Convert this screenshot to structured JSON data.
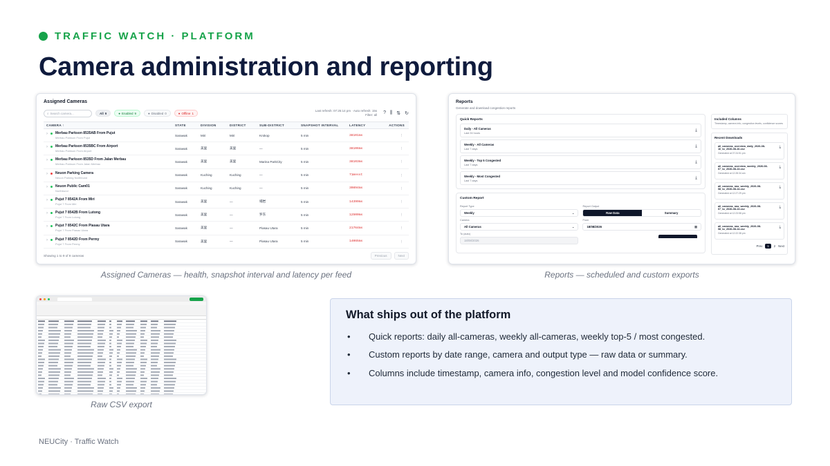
{
  "slide": {
    "eyebrow": "TRAFFIC WATCH · PLATFORM",
    "title": "Camera administration and reporting",
    "footer": "NEUCity · Traffic Watch",
    "accent_color": "#16a34a",
    "title_color": "#0f1b3d"
  },
  "cameras_panel": {
    "title": "Assigned Cameras",
    "search_placeholder": "Search camera...",
    "filters": [
      {
        "label": "All",
        "count": "9"
      },
      {
        "label": "Enabled",
        "count": "9"
      },
      {
        "label": "Disabled",
        "count": "0"
      },
      {
        "label": "Offline",
        "count": "1"
      }
    ],
    "refresh_text": "Last refresh: 07:25:14 pm · Auto refresh: 15s",
    "filter_text": "Filter: all",
    "columns": [
      "CAMERA ↑",
      "STATE",
      "DIVISION",
      "DISTRICT",
      "SUB-DISTRICT",
      "SNAPSHOT INTERVAL",
      "LATENCY",
      "ACTIONS"
    ],
    "rows": [
      {
        "name": "Merbau Parkson 8535AB From Pujut",
        "sub": "Merbau Parkson From Pujut",
        "status": "green",
        "state": "Sarawak",
        "division": "Miri",
        "district": "Miri",
        "subdistrict": "Krokop",
        "interval": "5 min",
        "latency": "38101ms"
      },
      {
        "name": "Merbau Parkson 8535BC From Airport",
        "sub": "Merbau Parkson From Airport",
        "status": "green",
        "state": "Sarawak",
        "division": "美里",
        "district": "美里",
        "subdistrict": "—",
        "interval": "5 min",
        "latency": "38106ms"
      },
      {
        "name": "Merbau Parkson 8535D From Jalan Merbau",
        "sub": "Merbau Parkson From Jalan Merbau",
        "status": "green",
        "state": "Sarawak",
        "division": "美里",
        "district": "美里",
        "subdistrict": "Marina ParkCity",
        "interval": "5 min",
        "latency": "38103ms"
      },
      {
        "name": "Neuon Parking Camera",
        "sub": "Neuon Parking Northbund",
        "status": "red",
        "state": "Sarawak",
        "division": "Kuching",
        "district": "Kuching",
        "subdistrict": "—",
        "interval": "5 min",
        "latency": "71messt"
      },
      {
        "name": "Neuon Public Cam01",
        "sub": "Northbund",
        "status": "green",
        "state": "Sarawak",
        "division": "Kuching",
        "district": "Kuching",
        "subdistrict": "—",
        "interval": "5 min",
        "latency": "30894ms"
      },
      {
        "name": "Pujut 7 8542A From Miri",
        "sub": "Pujut 7 From Miri",
        "status": "green",
        "state": "Sarawak",
        "division": "美里",
        "district": "—",
        "subdistrict": "埔岩",
        "interval": "5 min",
        "latency": "14399ms"
      },
      {
        "name": "Pujut 7 8542B From Lutong",
        "sub": "Pujut 7 From Lutong",
        "status": "green",
        "state": "Sarawak",
        "division": "美里",
        "district": "—",
        "subdistrict": "罗东",
        "interval": "5 min",
        "latency": "12500ms"
      },
      {
        "name": "Pujut 7 8542C From Piasau Utara",
        "sub": "Pujut 7 From Piasau Utara",
        "status": "green",
        "state": "Sarawak",
        "division": "美里",
        "district": "—",
        "subdistrict": "Piasau Utara",
        "interval": "5 min",
        "latency": "21764ms"
      },
      {
        "name": "Pujut 7 8542D From Permy",
        "sub": "Pujut 7 From Permy",
        "status": "green",
        "state": "Sarawak",
        "division": "美里",
        "district": "—",
        "subdistrict": "Piasau Utara",
        "interval": "5 min",
        "latency": "14065ms"
      }
    ],
    "showing": "Showing 1 to 9 of 9 cameras",
    "prev_label": "Previous",
    "next_label": "Next",
    "caption": "Assigned Cameras — health, snapshot interval and latency per feed"
  },
  "reports_panel": {
    "title": "Reports",
    "subtitle": "Generate and download congestion reports",
    "quick_title": "Quick Reports",
    "quick_reports": [
      {
        "name": "Daily - All Cameras",
        "period": "Last 24 hours"
      },
      {
        "name": "Weekly - All Cameras",
        "period": "Last 7 days"
      },
      {
        "name": "Weekly - Top 5 Congested",
        "period": "Last 7 days"
      },
      {
        "name": "Weekly - Most Congested",
        "period": "Last 7 days"
      }
    ],
    "custom_title": "Custom Report",
    "report_type_label": "Report Type",
    "report_type_value": "Weekly",
    "output_label": "Report Output",
    "output_options": [
      "Raw Data",
      "Summary"
    ],
    "camera_label": "Camera",
    "camera_value": "All Cameras",
    "from_label": "From",
    "from_value": "18/08/2026",
    "to_label": "To (auto)",
    "to_value": "18/08/2026",
    "included_title": "Included Columns",
    "included_text": "Timestamp, camera info, congestion levels, confidence scores",
    "recent_title": "Recent Downloads",
    "downloads": [
      {
        "file": "all_cameras_overview_daily_2026-08-16_to_2026-08-16.csv",
        "when": "Generated at 07:24:51 pm"
      },
      {
        "file": "all_cameras_overview_weekly_2026-08-07_to_2026-08-13.csv",
        "when": "Generated at 12:28:34 am"
      },
      {
        "file": "all_cameras_raw_weekly_2026-08-08_to_2026-08-14.csv",
        "when": "Generated at 12:27:29 pm"
      },
      {
        "file": "all_cameras_raw_weekly_2026-08-07_to_2026-08-13.csv",
        "when": "Generated at 12:23:58 pm"
      },
      {
        "file": "all_cameras_raw_weekly_2026-08-08_to_2026-08-14.csv",
        "when": "Generated at 12:22:38 pm"
      }
    ],
    "pager": {
      "prev": "Prev",
      "pages": [
        "1",
        "2"
      ],
      "next": "Next"
    },
    "caption": "Reports — scheduled and custom exports"
  },
  "csv_panel": {
    "caption": "Raw CSV export"
  },
  "ships_box": {
    "title": "What ships out of the platform",
    "bullets": [
      "Quick reports: daily all-cameras, weekly all-cameras, weekly top-5 / most congested.",
      "Custom reports by date range, camera and output type — raw data or summary.",
      "Columns include timestamp, camera info, congestion level and model confidence score."
    ]
  }
}
